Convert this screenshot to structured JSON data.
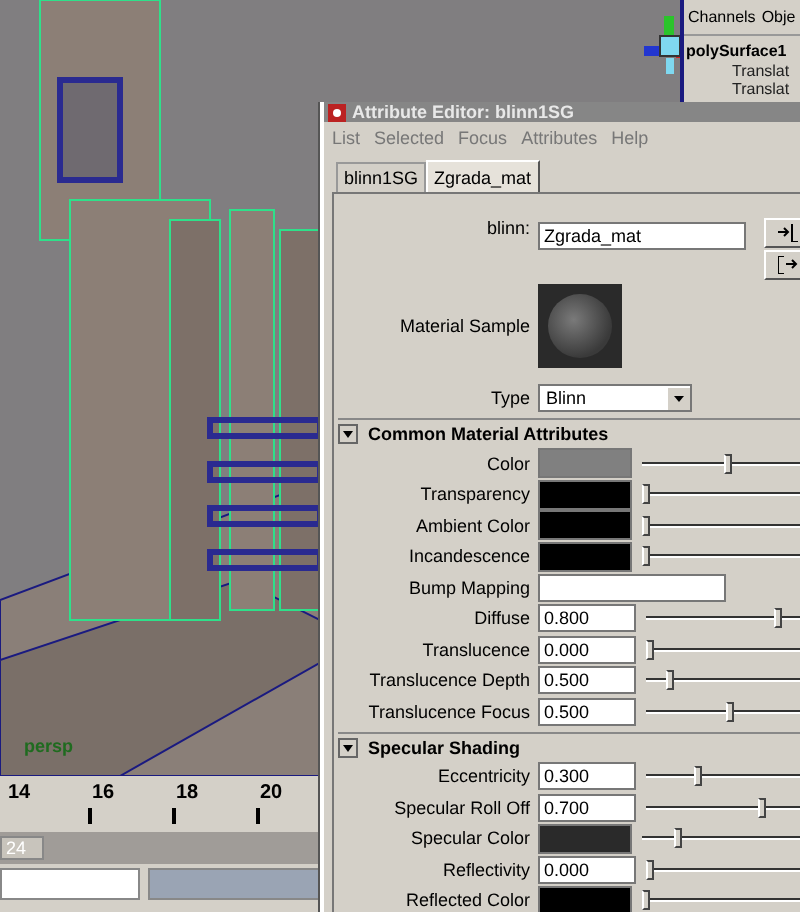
{
  "viewport": {
    "camera": "persp"
  },
  "channel_box": {
    "tabs": [
      "Channels",
      "Obje"
    ],
    "object": "polySurface1",
    "attributes": [
      "Translat",
      "Translat"
    ]
  },
  "timeline": {
    "ticks": [
      "14",
      "16",
      "18",
      "20"
    ]
  },
  "range_slider": {
    "end_frame": "24"
  },
  "attribute_editor": {
    "title": "Attribute Editor: blinn1SG",
    "menu": [
      "List",
      "Selected",
      "Focus",
      "Attributes",
      "Help"
    ],
    "tabs": [
      {
        "label": "blinn1SG",
        "selected": false
      },
      {
        "label": "Zgrada_mat",
        "selected": true
      }
    ],
    "node_label": "blinn:",
    "node_name": "Zgrada_mat",
    "sample_label": "Material Sample",
    "type_label": "Type",
    "type_value": "Blinn",
    "sections": [
      {
        "title": "Common Material Attributes",
        "expanded": true,
        "attributes": [
          {
            "kind": "color",
            "label": "Color",
            "color": "#808080",
            "level": 0.51
          },
          {
            "kind": "color",
            "label": "Transparency",
            "color": "#000000",
            "level": 0
          },
          {
            "kind": "color",
            "label": "Ambient Color",
            "color": "#000000",
            "level": 0
          },
          {
            "kind": "color",
            "label": "Incandescence",
            "color": "#000000",
            "level": 0
          },
          {
            "kind": "texture",
            "label": "Bump Mapping"
          },
          {
            "kind": "number",
            "label": "Diffuse",
            "value": "0.800",
            "level": 0.8
          },
          {
            "kind": "number",
            "label": "Translucence",
            "value": "0.000",
            "level": 0
          },
          {
            "kind": "number",
            "label": "Translucence Depth",
            "value": "0.500",
            "level": 0.12
          },
          {
            "kind": "number",
            "label": "Translucence Focus",
            "value": "0.500",
            "level": 0.5
          }
        ]
      },
      {
        "title": "Specular Shading",
        "expanded": true,
        "attributes": [
          {
            "kind": "number",
            "label": "Eccentricity",
            "value": "0.300",
            "level": 0.3
          },
          {
            "kind": "number",
            "label": "Specular Roll Off",
            "value": "0.700",
            "level": 0.7
          },
          {
            "kind": "color",
            "label": "Specular Color",
            "color": "#2a2a2a",
            "level": 0.2
          },
          {
            "kind": "number",
            "label": "Reflectivity",
            "value": "0.000",
            "level": 0
          },
          {
            "kind": "color",
            "label": "Reflected Color",
            "color": "#000000",
            "level": 0
          }
        ]
      }
    ]
  }
}
